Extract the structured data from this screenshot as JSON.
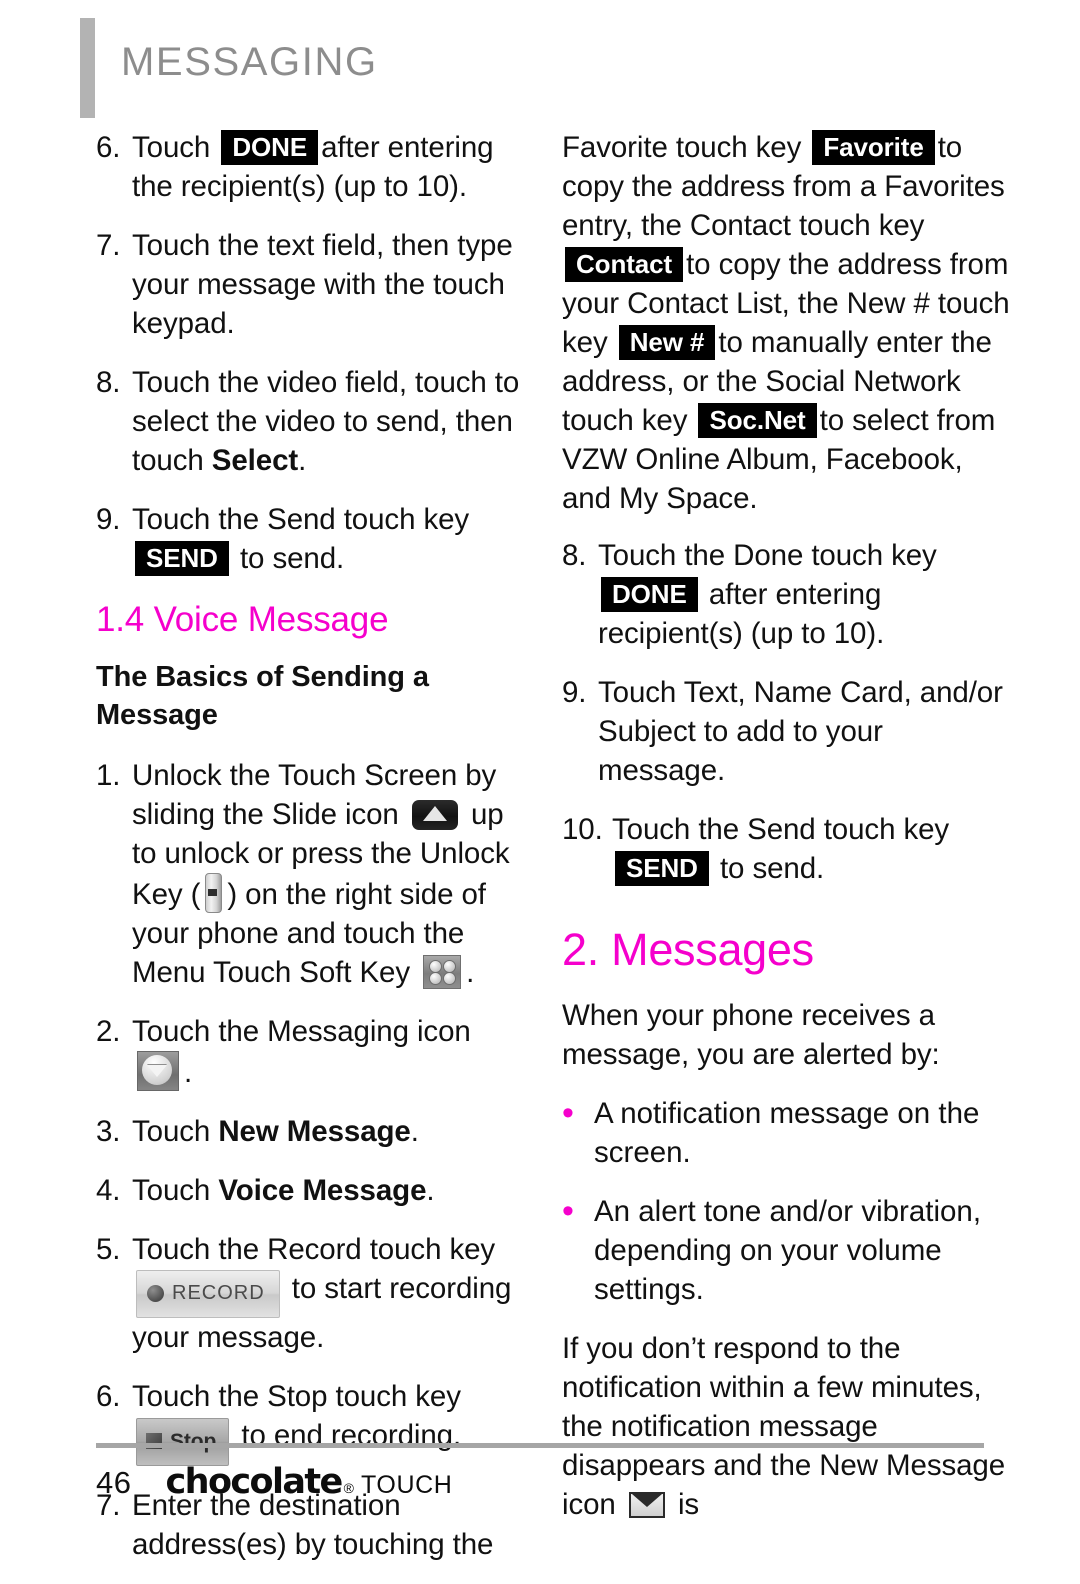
{
  "header": {
    "title": "MESSAGING",
    "accent_color": "#f500cc",
    "rule_color": "#b3b3b3"
  },
  "left_column": {
    "steps": [
      {
        "num": "6.",
        "pre": "Touch",
        "key": "DONE",
        "post": "after entering the recipient(s) (up to 10)."
      },
      {
        "num": "7.",
        "text": "Touch the text field, then type your message with the touch keypad."
      },
      {
        "num": "8.",
        "pre": "Touch the video field, touch to select the video to send, then touch",
        "bold": "Select",
        "post": "."
      },
      {
        "num": "9.",
        "pre": "Touch the Send touch key",
        "key": "SEND",
        "post": "to send."
      }
    ],
    "section_heading": "1.4 Voice Message",
    "sub_heading": "The Basics of Sending a Message",
    "steps2": [
      {
        "num": "1.",
        "p1": "Unlock the Touch Screen by sliding the Slide icon",
        "icon1": "slide-icon",
        "p2": "up to unlock or press the Unlock Key (",
        "icon2": "unlock-key-icon",
        "p3": ") on the right side of your phone and touch the Menu Touch Soft Key",
        "icon3": "menu-soft-key-icon",
        "p4": "."
      },
      {
        "num": "2.",
        "pre": "Touch the Messaging icon",
        "icon": "messaging-icon",
        "post": "."
      },
      {
        "num": "3.",
        "pre": "Touch",
        "bold": "New Message",
        "post": "."
      },
      {
        "num": "4.",
        "pre": "Touch",
        "bold": "Voice Message",
        "post": "."
      },
      {
        "num": "5.",
        "pre": "Touch the Record touch key",
        "gkey": "RECORD",
        "gkey_icon": "record-dot-icon",
        "post": "to start recording your message."
      },
      {
        "num": "6.",
        "pre": "Touch the Stop touch key",
        "gkey": "Stop",
        "gkey_icon": "stop-square-icon",
        "post": "to end recording."
      },
      {
        "num": "7.",
        "text": "Enter the destination address(es) by touching the"
      }
    ]
  },
  "right_column": {
    "intro": {
      "p1": "Favorite touch key",
      "key1": "Favorite",
      "p2": "to copy the address from a Favorites entry, the Contact touch key",
      "key2": "Contact",
      "p3": "to copy the address from your Contact List, the New # touch key",
      "key3": "New #",
      "p4": "to manually enter the address, or the Social Network touch key",
      "key4": "Soc.Net",
      "p5": "to select from VZW Online Album, Facebook, and My Space."
    },
    "steps": [
      {
        "num": "8.",
        "pre": "Touch the Done touch key",
        "key": "DONE",
        "post": "after entering recipient(s) (up to 10)."
      },
      {
        "num": "9.",
        "text": "Touch Text, Name Card, and/or Subject to add to your message."
      },
      {
        "num": "10.",
        "pre": "Touch the Send touch key",
        "key": "SEND",
        "post": "to send."
      }
    ],
    "section_heading": "2. Messages",
    "intro2": "When your phone receives a message, you are alerted by:",
    "bullets": [
      "A notification message on the screen.",
      "An alert tone and/or vibration, depending on your volume settings."
    ],
    "closing": {
      "p1": "If you don’t respond to the notification within a few minutes, the notification message disappears and the New Message icon",
      "icon": "new-message-envelope-icon",
      "p2": "is"
    }
  },
  "footer": {
    "page_number": "46",
    "logo_name": "chocolate",
    "logo_mark": "®",
    "logo_suffix": "TOUCH"
  }
}
